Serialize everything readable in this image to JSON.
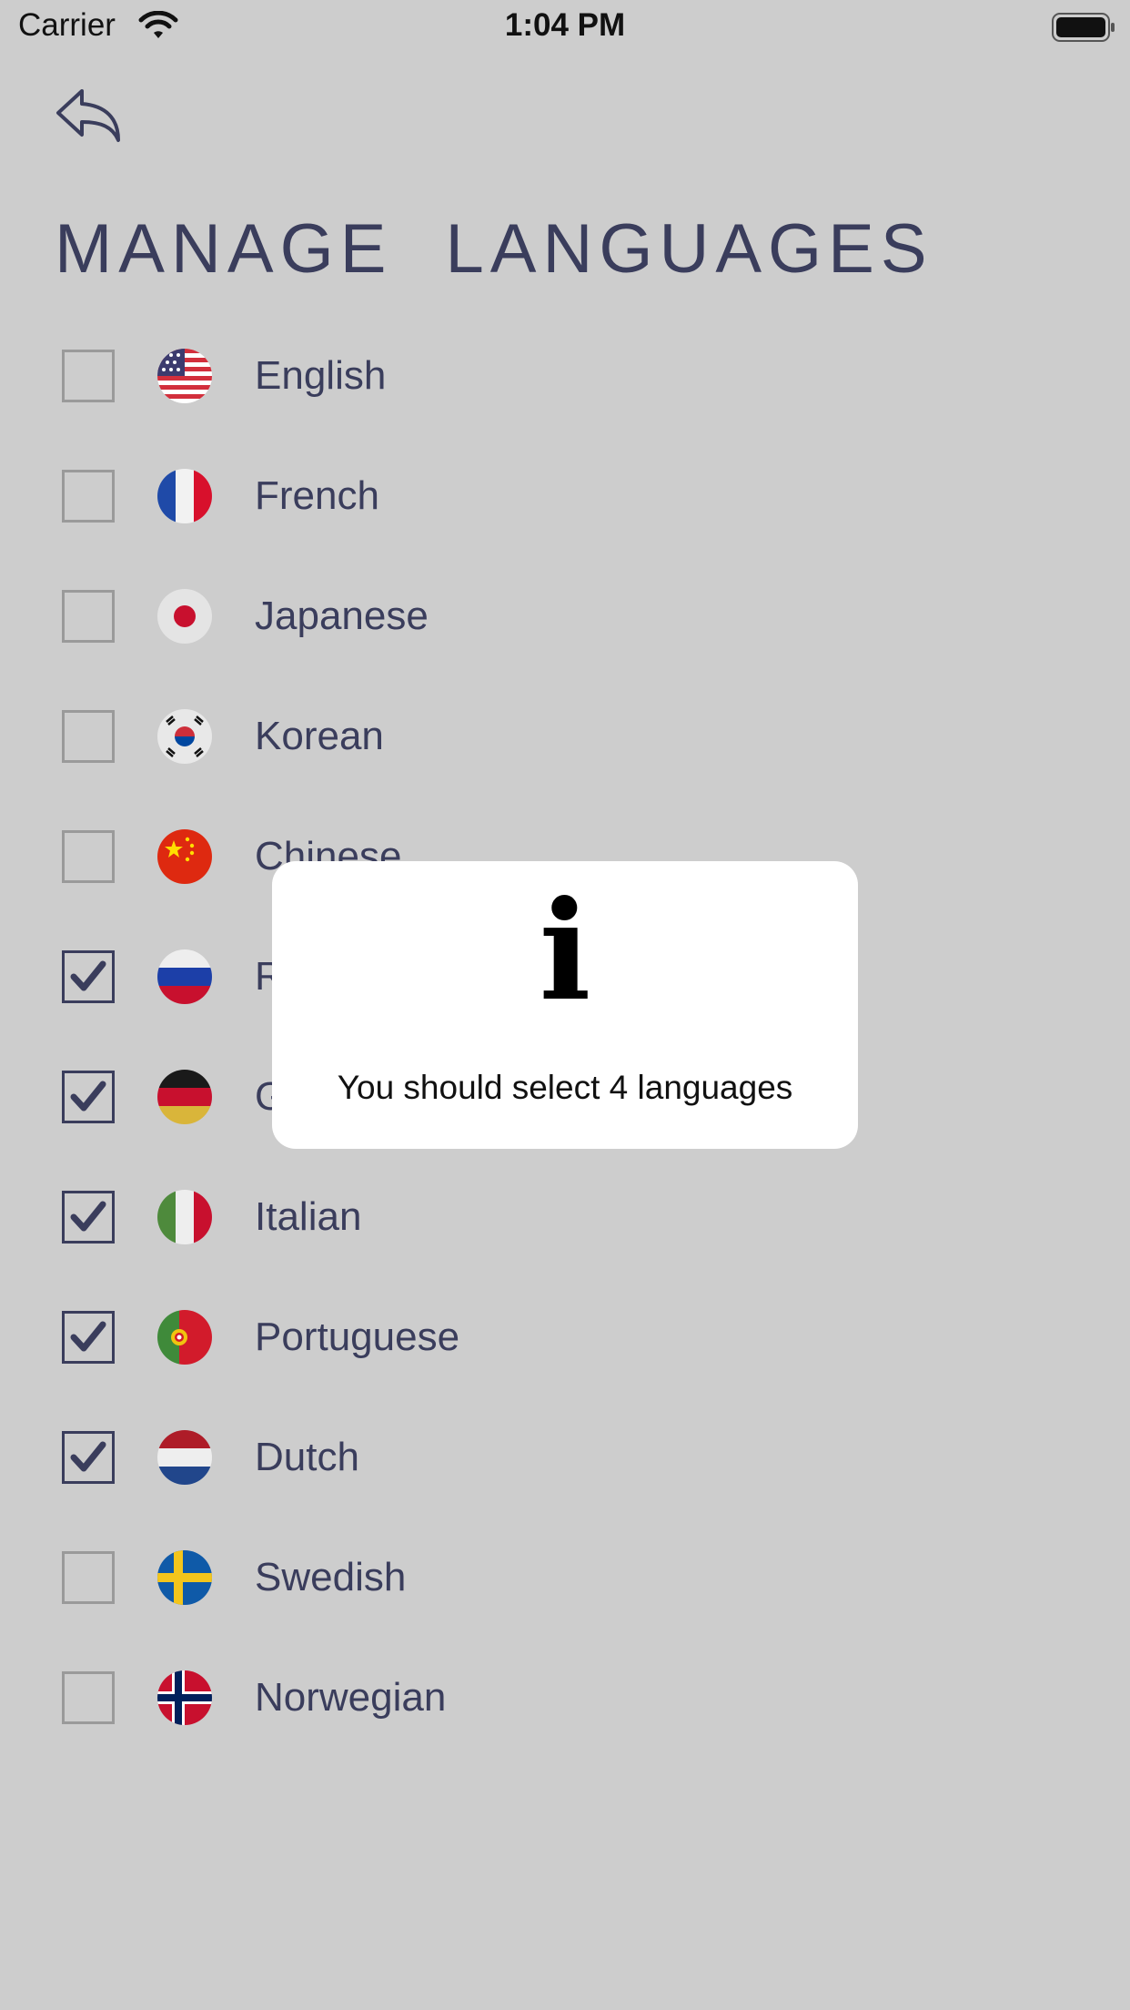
{
  "status_bar": {
    "carrier": "Carrier",
    "time": "1:04 PM"
  },
  "page": {
    "title": "MANAGE LANGUAGES"
  },
  "languages": [
    {
      "label": "English",
      "checked": false,
      "flag": "us-flag-icon"
    },
    {
      "label": "French",
      "checked": false,
      "flag": "fr-flag-icon"
    },
    {
      "label": "Japanese",
      "checked": false,
      "flag": "jp-flag-icon"
    },
    {
      "label": "Korean",
      "checked": false,
      "flag": "kr-flag-icon"
    },
    {
      "label": "Chinese",
      "checked": false,
      "flag": "cn-flag-icon"
    },
    {
      "label": "R",
      "checked": true,
      "flag": "ru-flag-icon"
    },
    {
      "label": "G",
      "checked": true,
      "flag": "de-flag-icon"
    },
    {
      "label": "Italian",
      "checked": true,
      "flag": "it-flag-icon"
    },
    {
      "label": "Portuguese",
      "checked": true,
      "flag": "pt-flag-icon"
    },
    {
      "label": "Dutch",
      "checked": true,
      "flag": "nl-flag-icon"
    },
    {
      "label": "Swedish",
      "checked": false,
      "flag": "se-flag-icon"
    },
    {
      "label": "Norwegian",
      "checked": false,
      "flag": "no-flag-icon"
    }
  ],
  "modal": {
    "icon": "i",
    "message": "You should select 4 languages"
  },
  "colors": {
    "background": "#cdcdcd",
    "text": "#3a3d5c",
    "modal_bg": "#ffffff"
  }
}
